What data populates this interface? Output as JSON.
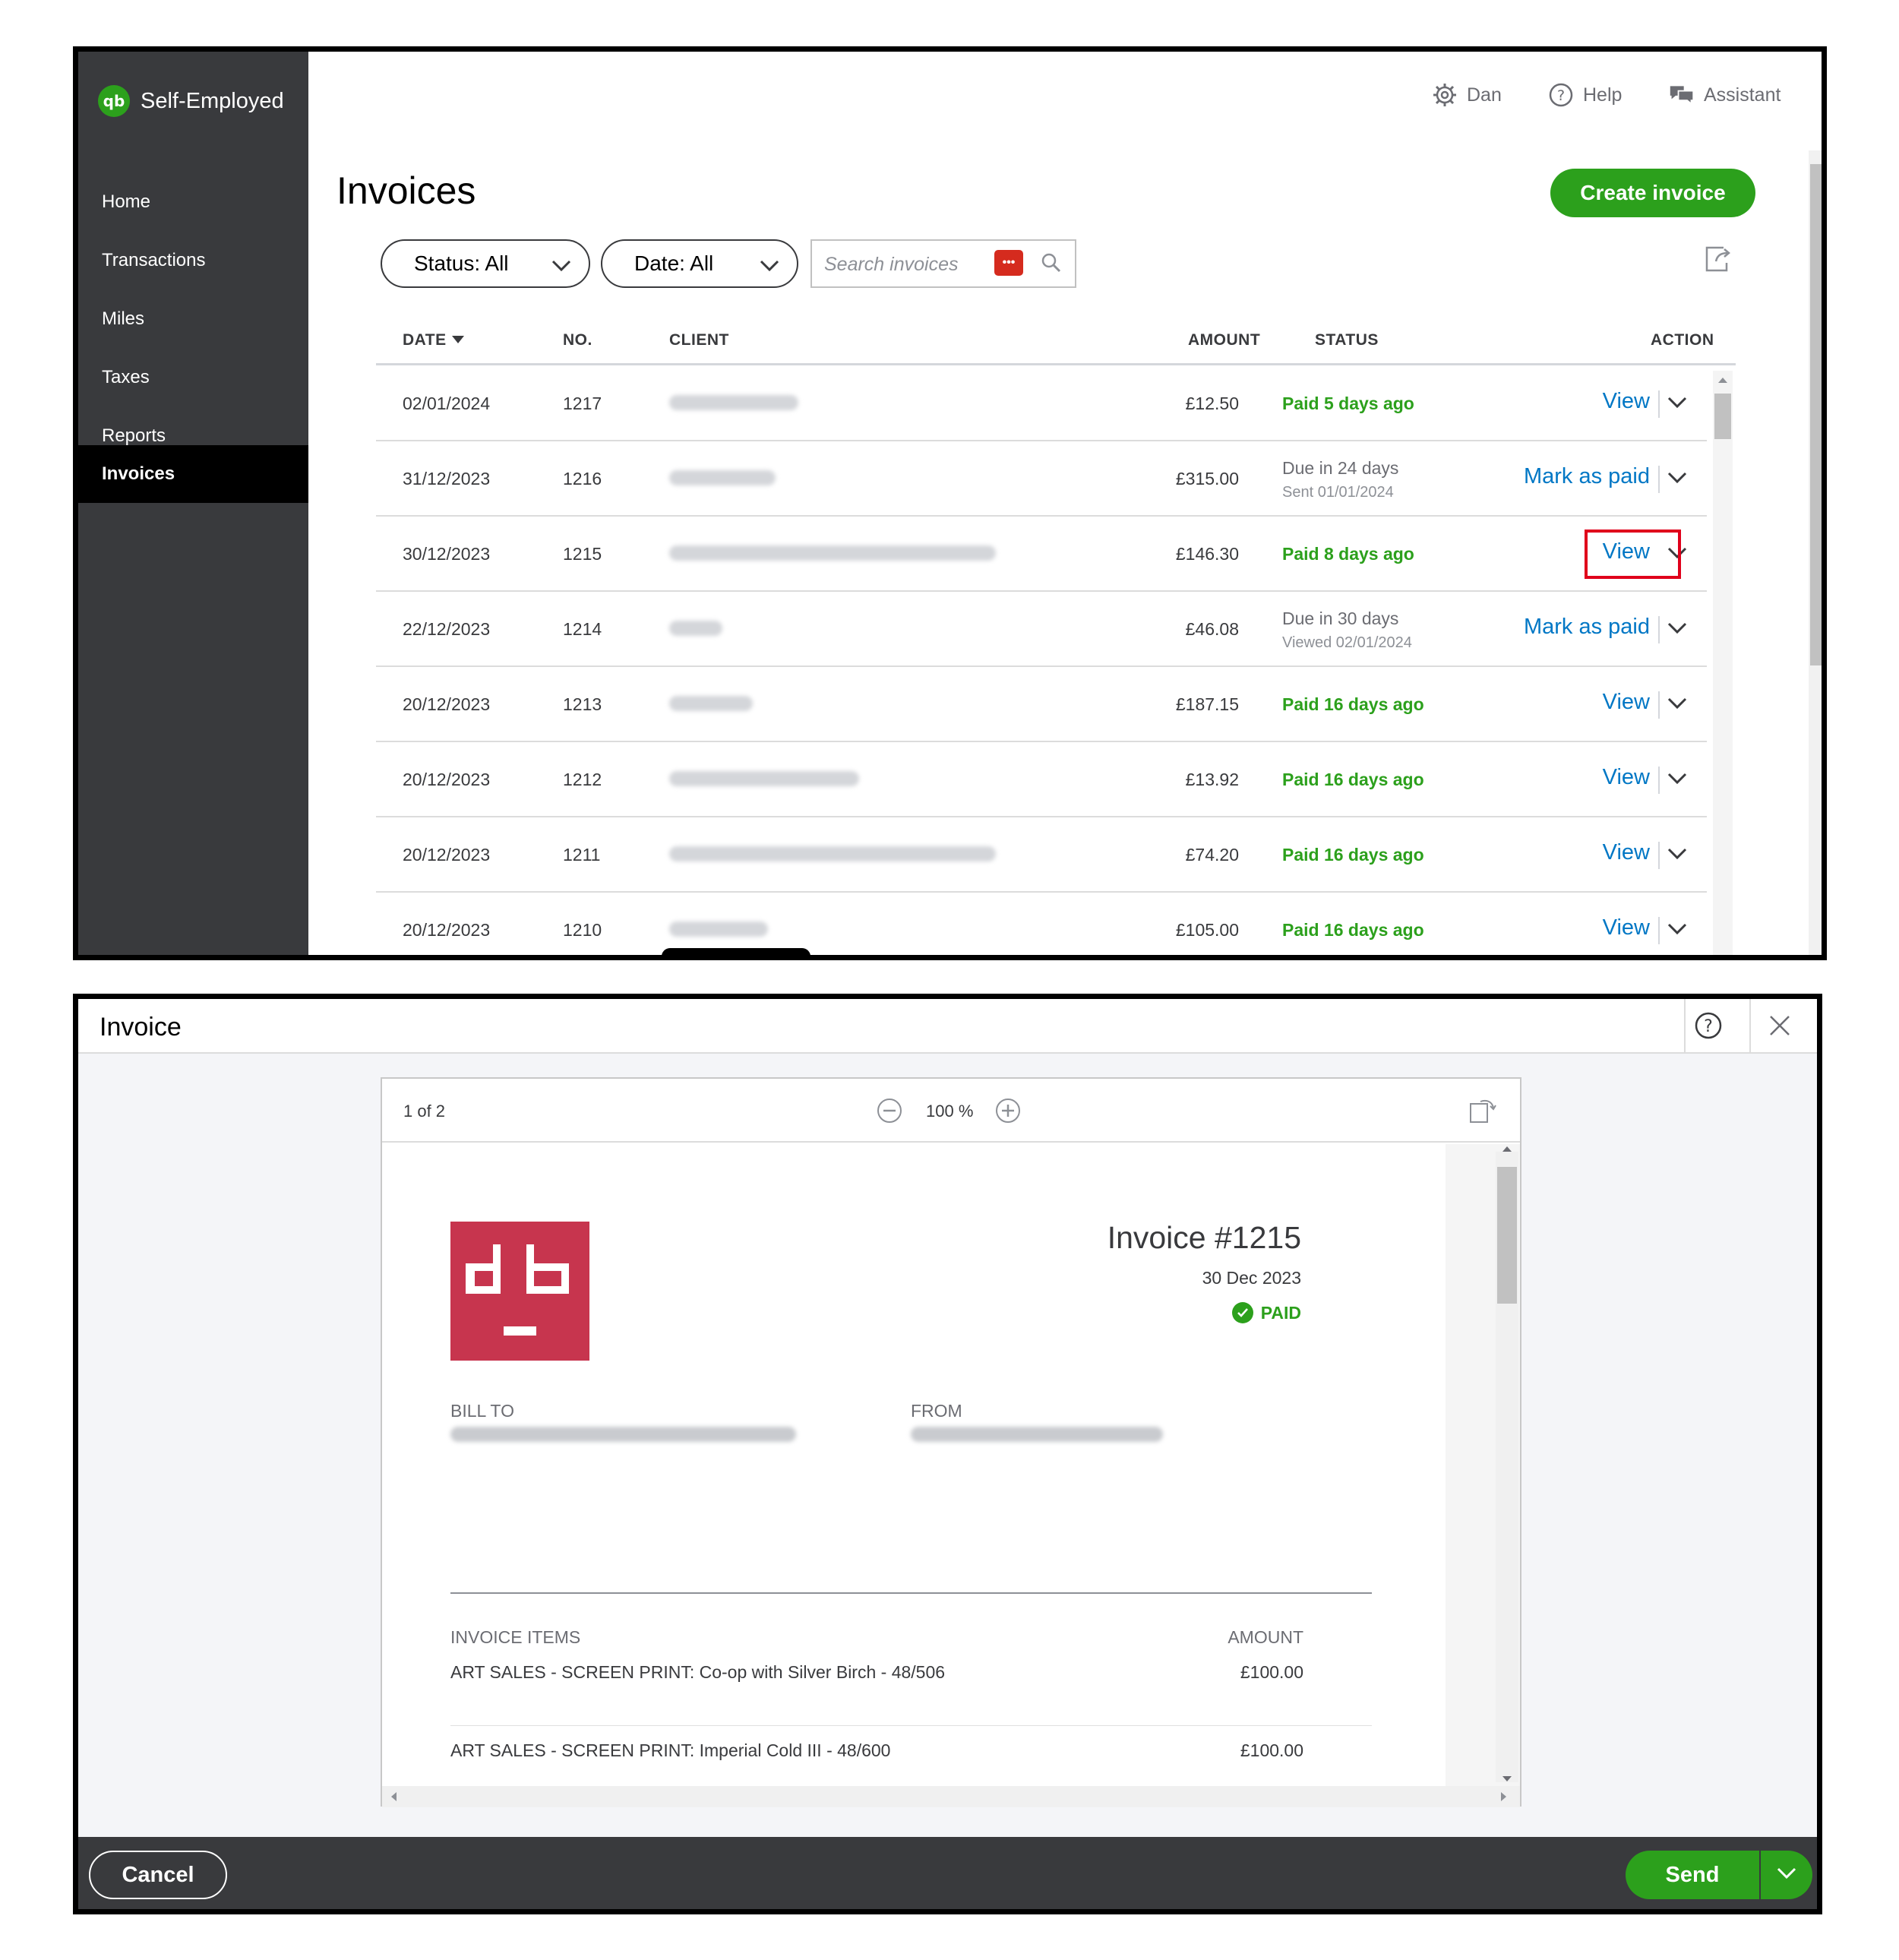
{
  "app": {
    "brand_icon": "qb",
    "brand_name": "Self-Employed"
  },
  "sidebar": {
    "items": [
      {
        "label": "Home"
      },
      {
        "label": "Transactions"
      },
      {
        "label": "Miles"
      },
      {
        "label": "Taxes"
      },
      {
        "label": "Reports"
      },
      {
        "label": "Invoices",
        "active": true
      }
    ]
  },
  "topbar": {
    "user": "Dan",
    "help": "Help",
    "assistant": "Assistant"
  },
  "page": {
    "title": "Invoices",
    "create_button": "Create invoice"
  },
  "filters": {
    "status": "Status: All",
    "date": "Date: All",
    "search_placeholder": "Search invoices"
  },
  "table": {
    "headers": {
      "date": "DATE",
      "no": "NO.",
      "client": "CLIENT",
      "amount": "AMOUNT",
      "status": "STATUS",
      "action": "ACTION"
    },
    "rows": [
      {
        "date": "02/01/2024",
        "no": "1217",
        "amount": "£12.50",
        "status": "Paid 5 days ago",
        "action": "View"
      },
      {
        "date": "31/12/2023",
        "no": "1216",
        "amount": "£315.00",
        "status": "Due in 24 days",
        "status_sub": "Sent 01/01/2024",
        "action": "Mark as paid"
      },
      {
        "date": "30/12/2023",
        "no": "1215",
        "amount": "£146.30",
        "status": "Paid 8 days ago",
        "action": "View"
      },
      {
        "date": "22/12/2023",
        "no": "1214",
        "amount": "£46.08",
        "status": "Due in 30 days",
        "status_sub": "Viewed 02/01/2024",
        "action": "Mark as paid"
      },
      {
        "date": "20/12/2023",
        "no": "1213",
        "amount": "£187.15",
        "status": "Paid 16 days ago",
        "action": "View"
      },
      {
        "date": "20/12/2023",
        "no": "1212",
        "amount": "£13.92",
        "status": "Paid 16 days ago",
        "action": "View"
      },
      {
        "date": "20/12/2023",
        "no": "1211",
        "amount": "£74.20",
        "status": "Paid 16 days ago",
        "action": "View"
      },
      {
        "date": "20/12/2023",
        "no": "1210",
        "amount": "£105.00",
        "status": "Paid 16 days ago",
        "action": "View"
      }
    ]
  },
  "modal": {
    "title": "Invoice",
    "page_indicator": "1 of 2",
    "zoom": "100 %",
    "invoice": {
      "title": "Invoice #1215",
      "date": "30 Dec 2023",
      "status": "PAID",
      "bill_to_label": "BILL TO",
      "from_label": "FROM",
      "items_label": "INVOICE ITEMS",
      "amount_label": "AMOUNT",
      "items": [
        {
          "description": "ART SALES - SCREEN PRINT: Co-op with Silver Birch - 48/506",
          "amount": "£100.00"
        },
        {
          "description": "ART SALES - SCREEN PRINT: Imperial Cold III - 48/600",
          "amount": "£100.00"
        }
      ]
    },
    "cancel_button": "Cancel",
    "send_button": "Send"
  },
  "colors": {
    "brand_green": "#2ca01c",
    "sidebar_bg": "#393a3d",
    "link_blue": "#0077c5",
    "highlight_red": "#e0001b",
    "logo_red": "#c7354e"
  }
}
